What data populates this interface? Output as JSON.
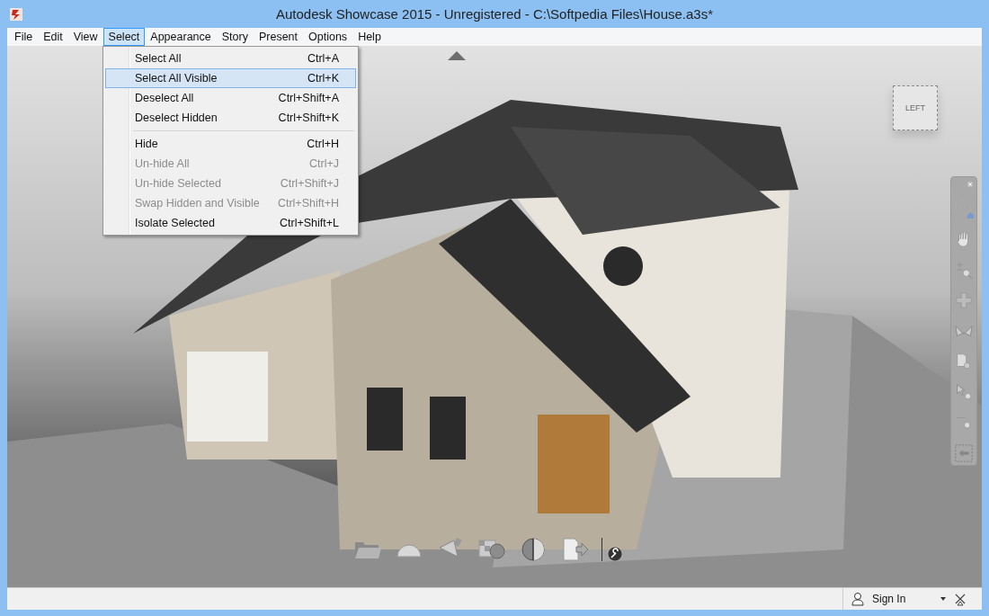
{
  "window": {
    "title": "Autodesk Showcase 2015 - Unregistered - C:\\Softpedia Files\\House.a3s*"
  },
  "menu_bar": [
    {
      "label": "File",
      "selected": false
    },
    {
      "label": "Edit",
      "selected": false
    },
    {
      "label": "View",
      "selected": false
    },
    {
      "label": "Select",
      "selected": true
    },
    {
      "label": "Appearance",
      "selected": false
    },
    {
      "label": "Story",
      "selected": false
    },
    {
      "label": "Present",
      "selected": false
    },
    {
      "label": "Options",
      "selected": false
    },
    {
      "label": "Help",
      "selected": false
    }
  ],
  "dropdown": {
    "items": [
      {
        "kind": "item",
        "label": "Select All",
        "shortcut": "Ctrl+A",
        "disabled": false,
        "selected": false
      },
      {
        "kind": "item",
        "label": "Select All Visible",
        "shortcut": "Ctrl+K",
        "disabled": false,
        "selected": true
      },
      {
        "kind": "item",
        "label": "Deselect All",
        "shortcut": "Ctrl+Shift+A",
        "disabled": false,
        "selected": false
      },
      {
        "kind": "item",
        "label": "Deselect Hidden",
        "shortcut": "Ctrl+Shift+K",
        "disabled": false,
        "selected": false
      },
      {
        "kind": "separator"
      },
      {
        "kind": "item",
        "label": "Hide",
        "shortcut": "Ctrl+H",
        "disabled": false,
        "selected": false
      },
      {
        "kind": "item",
        "label": "Un-hide All",
        "shortcut": "Ctrl+J",
        "disabled": true,
        "selected": false
      },
      {
        "kind": "item",
        "label": "Un-hide Selected",
        "shortcut": "Ctrl+Shift+J",
        "disabled": true,
        "selected": false
      },
      {
        "kind": "item",
        "label": "Swap Hidden and Visible",
        "shortcut": "Ctrl+Shift+H",
        "disabled": true,
        "selected": false
      },
      {
        "kind": "item",
        "label": "Isolate Selected",
        "shortcut": "Ctrl+Shift+L",
        "disabled": false,
        "selected": false
      }
    ]
  },
  "viewport": {
    "kind": "scene"
  },
  "view_cube": {
    "face_label": "LEFT"
  },
  "status_bar": {
    "sign_in": "Sign In"
  }
}
